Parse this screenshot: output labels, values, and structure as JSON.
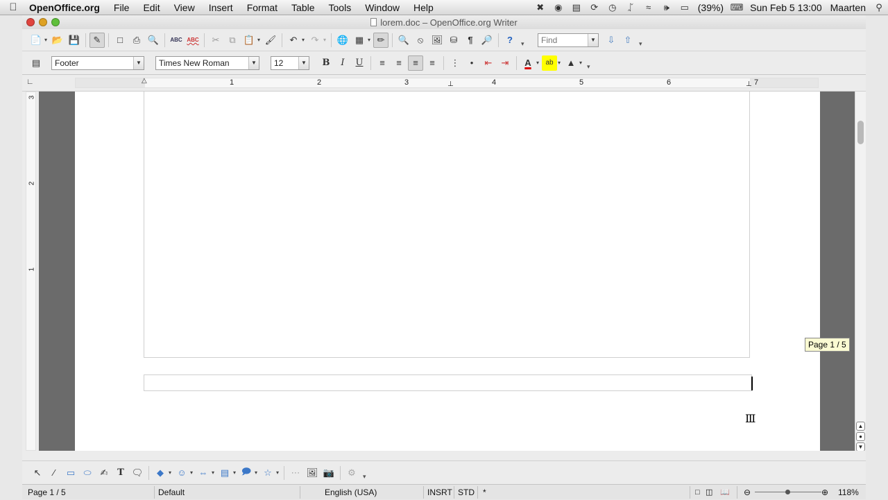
{
  "menubar": {
    "app_name": "OpenOffice.org",
    "items": [
      "File",
      "Edit",
      "View",
      "Insert",
      "Format",
      "Table",
      "Tools",
      "Window",
      "Help"
    ],
    "battery": "(39%)",
    "datetime": "Sun Feb 5  13:00",
    "user": "Maarten"
  },
  "window": {
    "title": "lorem.doc – OpenOffice.org Writer"
  },
  "formatting": {
    "paragraph_style": "Footer",
    "font_name": "Times New Roman",
    "font_size": "12",
    "bold_label": "B",
    "italic_label": "I",
    "underline_label": "U"
  },
  "find": {
    "placeholder": "Find"
  },
  "ruler": {
    "numbers": [
      "1",
      "2",
      "3",
      "4",
      "5",
      "6",
      "7"
    ],
    "vertical_numbers": [
      "3",
      "2",
      "1"
    ]
  },
  "document": {
    "page_tooltip": "Page 1 / 5"
  },
  "statusbar": {
    "page": "Page 1 / 5",
    "page_style": "Default",
    "language": "English (USA)",
    "insert_mode": "INSRT",
    "selection_mode": "STD",
    "modified": "*",
    "zoom": "118%"
  },
  "colors": {
    "page_background": "#ffffff",
    "canvas_background": "#6b6b6b",
    "toolbar_background": "#ececec"
  },
  "icons": {
    "toolbar1": [
      "new-icon",
      "open-icon",
      "save-icon",
      "edit-file-icon",
      "pdf-icon",
      "print-icon",
      "print-preview-icon",
      "spellcheck-icon",
      "autospell-icon",
      "cut-icon",
      "copy-icon",
      "paste-icon",
      "format-paintbrush-icon",
      "undo-icon",
      "redo-icon",
      "hyperlink-icon",
      "table-icon",
      "show-draw-functions-icon",
      "find-replace-icon",
      "navigator-icon",
      "gallery-icon",
      "data-sources-icon",
      "nonprinting-chars-icon",
      "zoom-icon",
      "help-icon"
    ],
    "drawing": [
      "select-icon",
      "line-icon",
      "rectangle-icon",
      "ellipse-icon",
      "freeform-icon",
      "text-icon",
      "callout-icon",
      "basic-shapes-icon",
      "symbol-shapes-icon",
      "block-arrows-icon",
      "flowchart-icon",
      "callouts-icon",
      "stars-icon",
      "points-icon",
      "fontwork-icon",
      "from-file-icon",
      "extrusion-icon"
    ]
  }
}
